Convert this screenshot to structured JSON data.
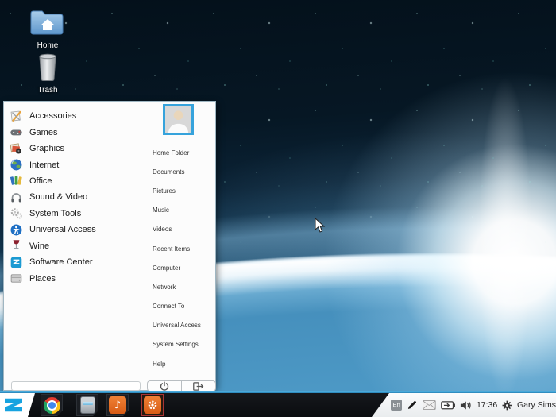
{
  "desktop": {
    "icons": [
      {
        "label": "Home",
        "icon": "home-folder-icon"
      },
      {
        "label": "Trash",
        "icon": "trash-icon"
      }
    ]
  },
  "menu": {
    "user_avatar": "generic-person-avatar",
    "categories": [
      {
        "label": "Accessories",
        "icon": "accessories-icon"
      },
      {
        "label": "Games",
        "icon": "games-icon"
      },
      {
        "label": "Graphics",
        "icon": "graphics-icon"
      },
      {
        "label": "Internet",
        "icon": "internet-icon"
      },
      {
        "label": "Office",
        "icon": "office-icon"
      },
      {
        "label": "Sound & Video",
        "icon": "sound-video-icon"
      },
      {
        "label": "System Tools",
        "icon": "system-tools-icon"
      },
      {
        "label": "Universal Access",
        "icon": "universal-access-icon"
      },
      {
        "label": "Wine",
        "icon": "wine-icon"
      },
      {
        "label": "Software Center",
        "icon": "software-center-icon"
      },
      {
        "label": "Places",
        "icon": "places-icon"
      }
    ],
    "search": {
      "value": "",
      "placeholder": ""
    },
    "places": [
      "Home Folder",
      "Documents",
      "Pictures",
      "Music",
      "Videos",
      "Recent Items",
      "Computer",
      "Network",
      "Connect To",
      "Universal Access",
      "System Settings",
      "Help"
    ],
    "session": [
      {
        "name": "shutdown",
        "icon": "power-icon"
      },
      {
        "name": "logout",
        "icon": "logout-icon"
      }
    ]
  },
  "taskbar": {
    "launcher": {
      "name": "zorin-start-menu",
      "icon": "zorin-z-icon"
    },
    "apps": [
      {
        "name": "chrome",
        "icon": "chrome-icon",
        "active": false
      },
      {
        "name": "file-manager",
        "icon": "file-manager-icon",
        "active": false
      },
      {
        "name": "music-player",
        "icon": "music-note-icon",
        "glyph": "♪",
        "active": false
      },
      {
        "name": "software-center",
        "icon": "gear-icon",
        "active": true
      }
    ],
    "tray": {
      "keyboard_layout": "En",
      "icons": [
        "pen-icon",
        "mail-icon",
        "battery-charging-icon",
        "volume-icon",
        "session-gear-icon"
      ],
      "time": "17:36",
      "user": "Gary Sims"
    }
  },
  "colors": {
    "taskbar_accent": "#2f93c8",
    "taskbar_bg": "#0b0d10",
    "active_app_border": "#a83434",
    "menu_bg": "#fcfcfc",
    "avatar_border": "#36a3dc",
    "zorin_blue": "#17a3e0"
  }
}
